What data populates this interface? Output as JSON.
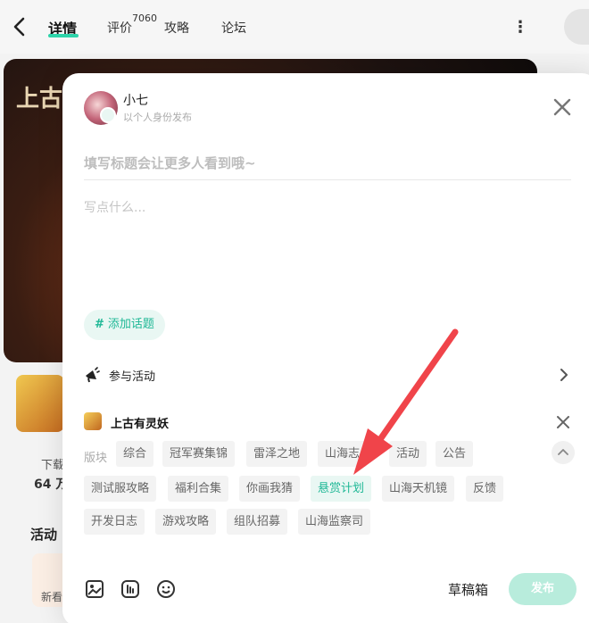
{
  "nav": {
    "tabs": [
      {
        "label": "详情"
      },
      {
        "label": "评价"
      },
      {
        "label": "攻略"
      },
      {
        "label": "论坛"
      }
    ],
    "review_count": "7060"
  },
  "background": {
    "banner_logo": "上古",
    "download_label": "下载",
    "download_value": "64 万",
    "activity_label": "活动",
    "newbie_label": "新看"
  },
  "composer": {
    "user": {
      "name": "小七",
      "identity": "以个人身份发布"
    },
    "title_placeholder": "填写标题会让更多人看到哦~",
    "body_placeholder": "写点什么...",
    "add_topic": "添加话题",
    "join_activity": "参与活动",
    "game_name": "上古有灵妖",
    "board_label": "版块",
    "tags": [
      {
        "label": "综合",
        "selected": false
      },
      {
        "label": "冠军赛集锦",
        "selected": false
      },
      {
        "label": "雷泽之地",
        "selected": false
      },
      {
        "label": "山海志",
        "selected": false
      },
      {
        "label": "活动",
        "selected": false
      },
      {
        "label": "公告",
        "selected": false
      },
      {
        "label": "测试服攻略",
        "selected": false
      },
      {
        "label": "福利合集",
        "selected": false
      },
      {
        "label": "你画我猜",
        "selected": false
      },
      {
        "label": "悬赏计划",
        "selected": true
      },
      {
        "label": "山海天机镜",
        "selected": false
      },
      {
        "label": "反馈",
        "selected": false
      },
      {
        "label": "开发日志",
        "selected": false
      },
      {
        "label": "游戏攻略",
        "selected": false
      },
      {
        "label": "组队招募",
        "selected": false
      },
      {
        "label": "山海监察司",
        "selected": false
      }
    ],
    "draft": "草稿箱",
    "publish": "发布"
  },
  "colors": {
    "accent": "#1fb896",
    "accent_light": "#e9f7f3",
    "arrow": "#f0444a",
    "publish_disabled": "#b8ecdc"
  }
}
